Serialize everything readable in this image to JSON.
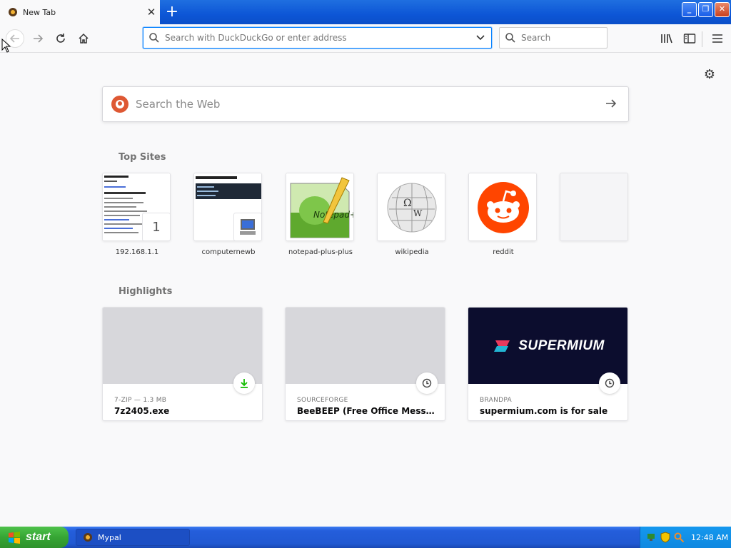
{
  "window": {
    "tab_title": "New Tab",
    "tab_close": "✕",
    "new_tab": "+",
    "min": "_",
    "max": "❐",
    "close": "✕"
  },
  "toolbar": {
    "url_placeholder": "Search with DuckDuckGo or enter address",
    "search_placeholder": "Search"
  },
  "newtab": {
    "websearch_placeholder": "Search the Web",
    "top_sites_title": "Top Sites",
    "highlights_title": "Highlights",
    "top_sites": [
      {
        "label": "192.168.1.1",
        "badge": "1"
      },
      {
        "label": "computernewb"
      },
      {
        "label": "notepad-plus-plus"
      },
      {
        "label": "wikipedia"
      },
      {
        "label": "reddit"
      },
      {
        "label": ""
      }
    ],
    "highlights": [
      {
        "meta": "7-ZIP — 1.3 MB",
        "title": "7z2405.exe",
        "icon": "download-icon"
      },
      {
        "meta": "SOURCEFORGE",
        "title": "BeeBEEP (Free Office Messeng...",
        "icon": "clock-icon"
      },
      {
        "meta": "BRANDPA",
        "title": "supermium.com is for sale",
        "icon": "clock-icon",
        "image_text": "SUPERMIUM"
      }
    ]
  },
  "taskbar": {
    "start_label": "start",
    "task_label": "Mypal",
    "clock": "12:48 AM"
  },
  "colors": {
    "accent": "#0a84ff",
    "xp_blue": "#245edb",
    "start_green": "#36a534",
    "ddg_orange": "#de5833",
    "reddit_orange": "#ff4500"
  }
}
